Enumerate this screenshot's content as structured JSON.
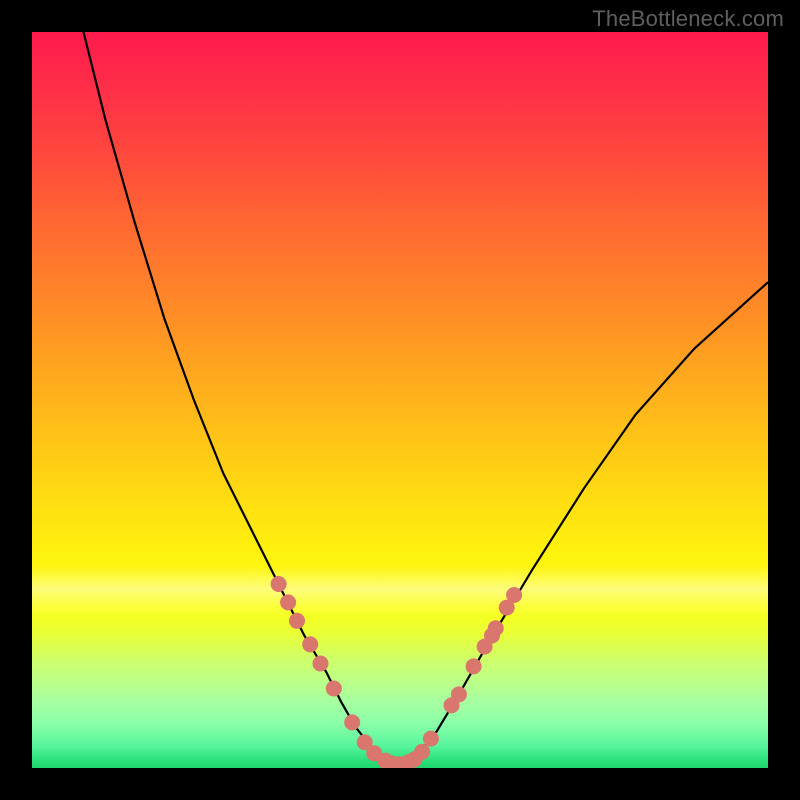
{
  "watermark": "TheBottleneck.com",
  "colors": {
    "frame": "#000000",
    "curve": "#000000",
    "markerFill": "#d9766d",
    "markerStroke": "#d9766d"
  },
  "chart_data": {
    "type": "line",
    "title": "",
    "xlabel": "",
    "ylabel": "",
    "xlim": [
      0,
      100
    ],
    "ylim": [
      0,
      100
    ],
    "grid": false,
    "series": [
      {
        "name": "curve",
        "x": [
          7,
          10,
          14,
          18,
          22,
          26,
          30,
          34,
          37,
          40,
          42,
          44,
          46,
          47,
          48,
          50,
          52,
          53,
          55,
          58,
          62,
          68,
          75,
          82,
          90,
          100
        ],
        "y": [
          100,
          88,
          74,
          61,
          50,
          40,
          32,
          24,
          18,
          13,
          9,
          5.5,
          3,
          1.8,
          1,
          0.5,
          1.2,
          2.5,
          5,
          10,
          17,
          27,
          38,
          48,
          57,
          66
        ]
      }
    ],
    "markers": [
      {
        "x": 33.5,
        "y": 25.0
      },
      {
        "x": 34.8,
        "y": 22.5
      },
      {
        "x": 36.0,
        "y": 20.0
      },
      {
        "x": 37.8,
        "y": 16.8
      },
      {
        "x": 39.2,
        "y": 14.2
      },
      {
        "x": 41.0,
        "y": 10.8
      },
      {
        "x": 43.5,
        "y": 6.2
      },
      {
        "x": 45.2,
        "y": 3.5
      },
      {
        "x": 46.5,
        "y": 2.0
      },
      {
        "x": 48.0,
        "y": 1.0
      },
      {
        "x": 49.0,
        "y": 0.6
      },
      {
        "x": 50.0,
        "y": 0.5
      },
      {
        "x": 51.2,
        "y": 0.8
      },
      {
        "x": 52.0,
        "y": 1.2
      },
      {
        "x": 53.0,
        "y": 2.2
      },
      {
        "x": 54.2,
        "y": 4.0
      },
      {
        "x": 57.0,
        "y": 8.5
      },
      {
        "x": 58.0,
        "y": 10.0
      },
      {
        "x": 60.0,
        "y": 13.8
      },
      {
        "x": 61.5,
        "y": 16.5
      },
      {
        "x": 62.5,
        "y": 18.0
      },
      {
        "x": 63.0,
        "y": 19.0
      },
      {
        "x": 64.5,
        "y": 21.8
      },
      {
        "x": 65.5,
        "y": 23.5
      }
    ]
  }
}
